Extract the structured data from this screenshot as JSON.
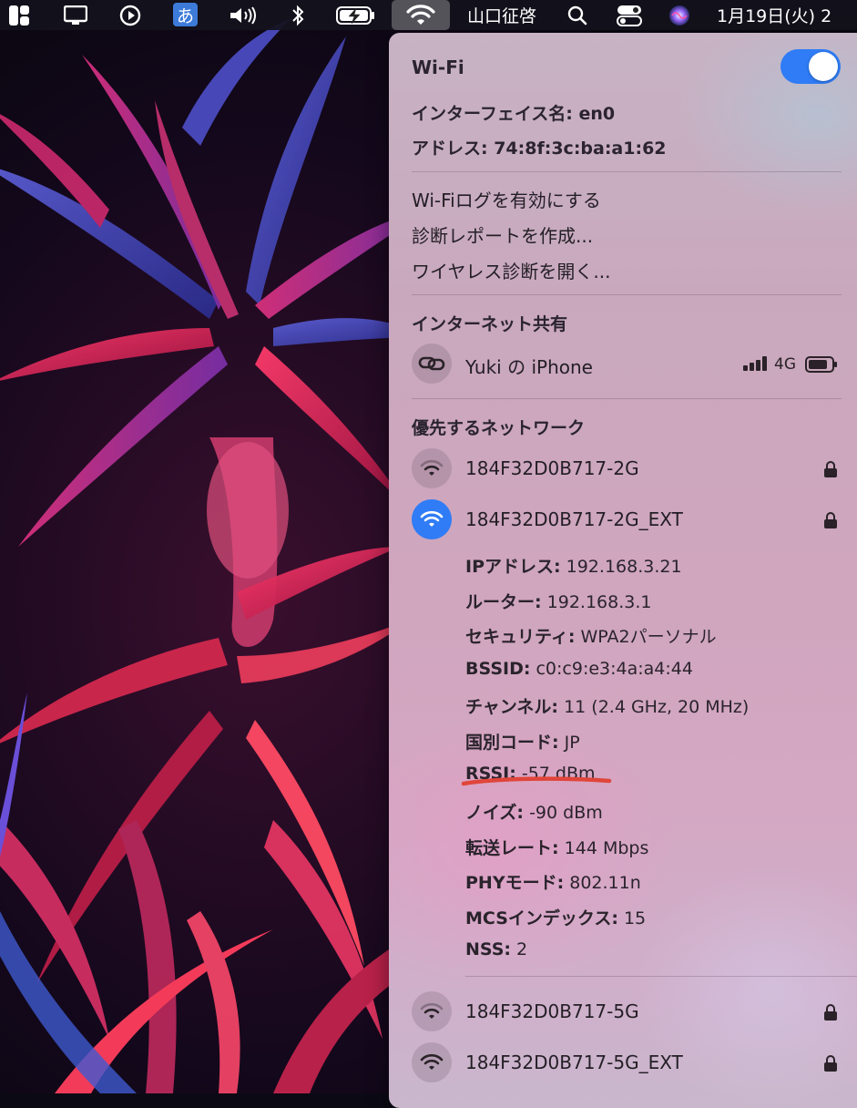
{
  "menubar": {
    "ime_label": "あ",
    "user_name": "山口征啓",
    "clock": "1月19日(火) 2",
    "icons": [
      "window-manager-icon",
      "display-icon",
      "play-icon",
      "ime-icon",
      "volume-icon",
      "bluetooth-icon",
      "battery-charging-icon",
      "wifi-icon",
      "search-icon",
      "control-center-icon",
      "siri-icon"
    ]
  },
  "wifi_menu": {
    "title": "Wi-Fi",
    "toggle_on": true,
    "interface": "インターフェイス名: en0",
    "address": "アドレス: 74:8f:3c:ba:a1:62",
    "actions": [
      "Wi-Fiログを有効にする",
      "診断レポートを作成...",
      "ワイヤレス診断を開く..."
    ],
    "hotspot_heading": "インターネット共有",
    "hotspot": {
      "name": "Yuki の iPhone",
      "network_type": "4G"
    },
    "preferred_heading": "優先するネットワーク",
    "networks": [
      {
        "name": "184F32D0B717-2G",
        "locked": true,
        "active": false
      },
      {
        "name": "184F32D0B717-2G_EXT",
        "locked": true,
        "active": true
      },
      {
        "name": "184F32D0B717-5G",
        "locked": true,
        "active": false
      },
      {
        "name": "184F32D0B717-5G_EXT",
        "locked": true,
        "active": false
      }
    ],
    "details": [
      {
        "key": "IPアドレス:",
        "value": " 192.168.3.21"
      },
      {
        "key": "ルーター:",
        "value": " 192.168.3.1"
      },
      {
        "key": "セキュリティ:",
        "value": " WPA2パーソナル"
      },
      {
        "key": "BSSID:",
        "value": " c0:c9:e3:4a:a4:44"
      },
      {
        "key": "チャンネル:",
        "value": " 11 (2.4 GHz, 20 MHz)"
      },
      {
        "key": "国別コード:",
        "value": " JP"
      },
      {
        "key": "RSSI:",
        "value": " -57 dBm"
      },
      {
        "key": "ノイズ:",
        "value": " -90 dBm"
      },
      {
        "key": "転送レート:",
        "value": " 144 Mbps"
      },
      {
        "key": "PHYモード:",
        "value": " 802.11n"
      },
      {
        "key": "MCSインデックス:",
        "value": " 15"
      },
      {
        "key": "NSS:",
        "value": " 2"
      }
    ],
    "highlight_color": "#e0453a",
    "accent_color": "#2f7cf6"
  }
}
